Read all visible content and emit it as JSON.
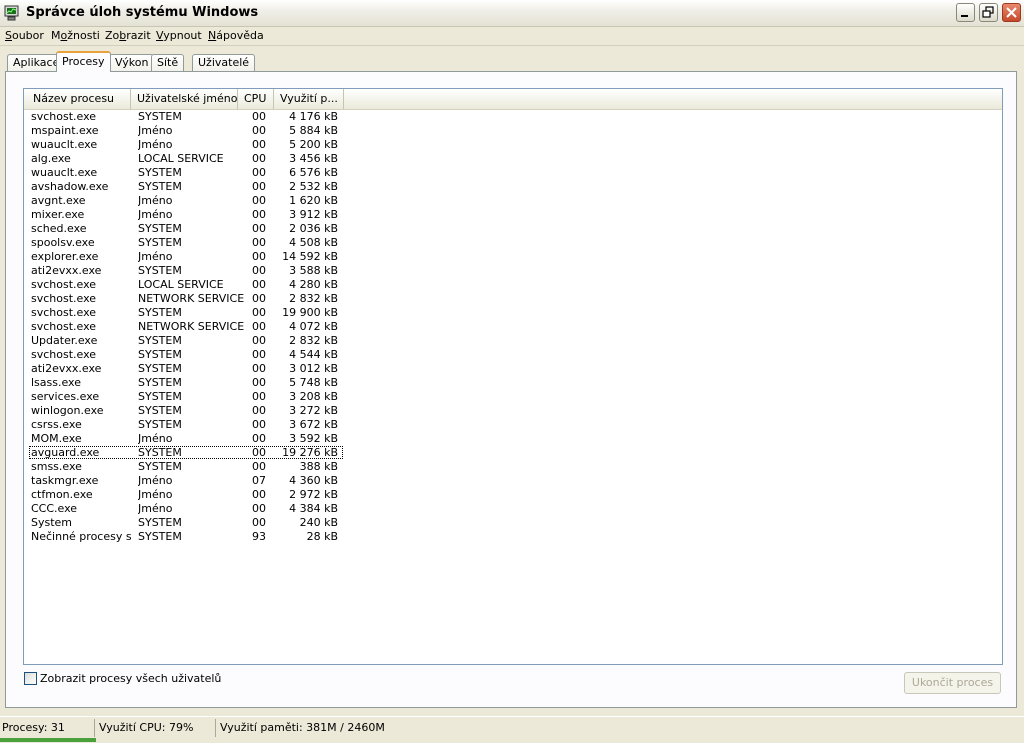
{
  "window": {
    "title": "Správce úloh systému Windows"
  },
  "menu": [
    {
      "label_u": "S",
      "label_rest": "oubor"
    },
    {
      "label_pre": "M",
      "label_u": "o",
      "label_rest": "žnosti",
      "full": "Možnosti"
    },
    {
      "label_pre": "Zo",
      "label_u": "b",
      "label_rest": "razit",
      "full": "Zobrazit"
    },
    {
      "label_u": "V",
      "label_rest": "ypnout"
    },
    {
      "label_u": "N",
      "label_rest": "ápověda"
    }
  ],
  "tabs": [
    "Aplikace",
    "Procesy",
    "Výkon",
    "Sítě",
    "Uživatelé"
  ],
  "active_tab": "Procesy",
  "columns": [
    "Název procesu",
    "Uživatelské jméno",
    "CPU",
    "Využití p..."
  ],
  "processes": [
    {
      "name": "svchost.exe",
      "user": "SYSTEM",
      "cpu": "00",
      "mem": "4 176 kB"
    },
    {
      "name": "mspaint.exe",
      "user": "Jméno",
      "cpu": "00",
      "mem": "5 884 kB"
    },
    {
      "name": "wuauclt.exe",
      "user": "Jméno",
      "cpu": "00",
      "mem": "5 200 kB"
    },
    {
      "name": "alg.exe",
      "user": "LOCAL SERVICE",
      "cpu": "00",
      "mem": "3 456 kB"
    },
    {
      "name": "wuauclt.exe",
      "user": "SYSTEM",
      "cpu": "00",
      "mem": "6 576 kB"
    },
    {
      "name": "avshadow.exe",
      "user": "SYSTEM",
      "cpu": "00",
      "mem": "2 532 kB"
    },
    {
      "name": "avgnt.exe",
      "user": "Jméno",
      "cpu": "00",
      "mem": "1 620 kB"
    },
    {
      "name": "mixer.exe",
      "user": "Jméno",
      "cpu": "00",
      "mem": "3 912 kB"
    },
    {
      "name": "sched.exe",
      "user": "SYSTEM",
      "cpu": "00",
      "mem": "2 036 kB"
    },
    {
      "name": "spoolsv.exe",
      "user": "SYSTEM",
      "cpu": "00",
      "mem": "4 508 kB"
    },
    {
      "name": "explorer.exe",
      "user": "Jméno",
      "cpu": "00",
      "mem": "14 592 kB"
    },
    {
      "name": "ati2evxx.exe",
      "user": "SYSTEM",
      "cpu": "00",
      "mem": "3 588 kB"
    },
    {
      "name": "svchost.exe",
      "user": "LOCAL SERVICE",
      "cpu": "00",
      "mem": "4 280 kB"
    },
    {
      "name": "svchost.exe",
      "user": "NETWORK SERVICE",
      "cpu": "00",
      "mem": "2 832 kB"
    },
    {
      "name": "svchost.exe",
      "user": "SYSTEM",
      "cpu": "00",
      "mem": "19 900 kB"
    },
    {
      "name": "svchost.exe",
      "user": "NETWORK SERVICE",
      "cpu": "00",
      "mem": "4 072 kB"
    },
    {
      "name": "Updater.exe",
      "user": "SYSTEM",
      "cpu": "00",
      "mem": "2 832 kB"
    },
    {
      "name": "svchost.exe",
      "user": "SYSTEM",
      "cpu": "00",
      "mem": "4 544 kB"
    },
    {
      "name": "ati2evxx.exe",
      "user": "SYSTEM",
      "cpu": "00",
      "mem": "3 012 kB"
    },
    {
      "name": "lsass.exe",
      "user": "SYSTEM",
      "cpu": "00",
      "mem": "5 748 kB"
    },
    {
      "name": "services.exe",
      "user": "SYSTEM",
      "cpu": "00",
      "mem": "3 208 kB"
    },
    {
      "name": "winlogon.exe",
      "user": "SYSTEM",
      "cpu": "00",
      "mem": "3 272 kB"
    },
    {
      "name": "csrss.exe",
      "user": "SYSTEM",
      "cpu": "00",
      "mem": "3 672 kB"
    },
    {
      "name": "MOM.exe",
      "user": "Jméno",
      "cpu": "00",
      "mem": "3 592 kB"
    },
    {
      "name": "avguard.exe",
      "user": "SYSTEM",
      "cpu": "00",
      "mem": "19 276 kB",
      "selected": true
    },
    {
      "name": "smss.exe",
      "user": "SYSTEM",
      "cpu": "00",
      "mem": "388 kB"
    },
    {
      "name": "taskmgr.exe",
      "user": "Jméno",
      "cpu": "07",
      "mem": "4 360 kB"
    },
    {
      "name": "ctfmon.exe",
      "user": "Jméno",
      "cpu": "00",
      "mem": "2 972 kB"
    },
    {
      "name": "CCC.exe",
      "user": "Jméno",
      "cpu": "00",
      "mem": "4 384 kB"
    },
    {
      "name": "System",
      "user": "SYSTEM",
      "cpu": "00",
      "mem": "240 kB"
    },
    {
      "name": "Nečinné procesy s...",
      "user": "SYSTEM",
      "cpu": "93",
      "mem": "28 kB"
    }
  ],
  "show_all_users": {
    "label": "Zobrazit procesy všech uživatelů",
    "checked": false
  },
  "end_process_button": "Ukončit proces",
  "status": {
    "processes": "Procesy: 31",
    "cpu": "Využití CPU: 79%",
    "memory": "Využití paměti: 381M / 2460M"
  },
  "icons": {
    "app": "task-manager-icon",
    "minimize": "minimize-icon",
    "maximize": "restore-icon",
    "close": "close-icon"
  }
}
